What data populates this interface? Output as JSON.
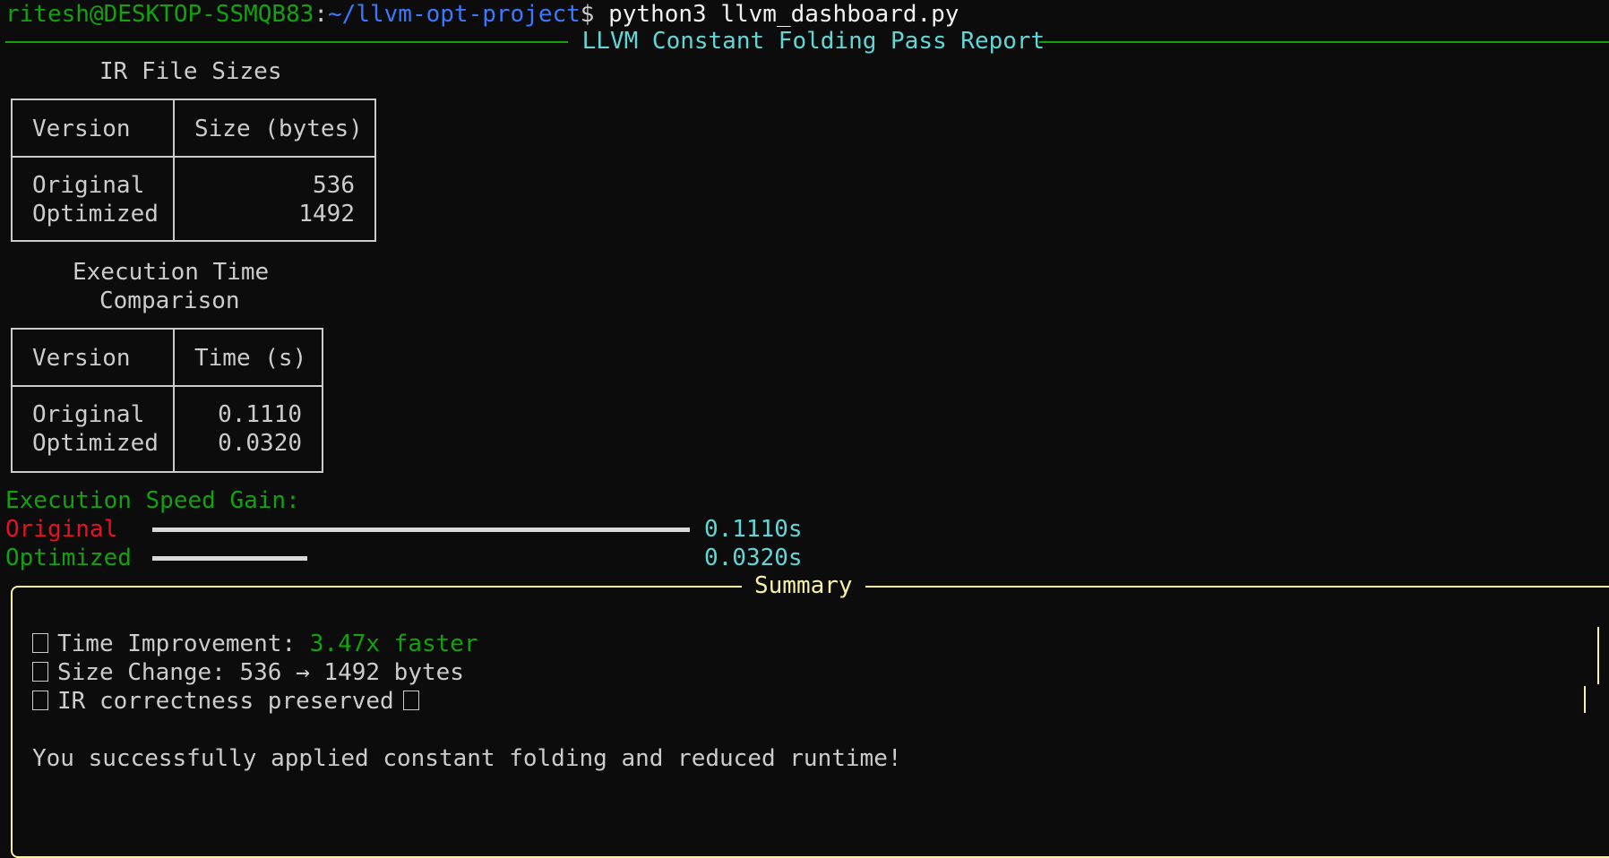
{
  "prompt": {
    "user_host": "ritesh@DESKTOP-SSMQB83",
    "separator": ":",
    "path": "~/llvm-opt-project",
    "dollar": "$",
    "command": " python3 llvm_dashboard.py"
  },
  "report_title": " LLVM Constant Folding Pass Report ",
  "ir_sizes": {
    "title": "IR File Sizes",
    "header": [
      "Version",
      "Size (bytes)"
    ],
    "rows": [
      {
        "version": "Original",
        "value": "536"
      },
      {
        "version": "Optimized",
        "value": "1492"
      }
    ]
  },
  "exec_time": {
    "title_line1": "Execution Time",
    "title_line2": "Comparison",
    "header": [
      "Version",
      "Time (s)"
    ],
    "rows": [
      {
        "version": "Original",
        "value": "0.1110"
      },
      {
        "version": "Optimized",
        "value": "0.0320"
      }
    ]
  },
  "speed_gain": {
    "title": "Execution Speed Gain:",
    "bars": [
      {
        "label": "Original",
        "value_text": "0.1110s",
        "fraction": 1.0
      },
      {
        "label": "Optimized",
        "value_text": "0.0320s",
        "fraction": 0.288
      }
    ]
  },
  "summary": {
    "title": "Summary",
    "time_label": "Time Improvement: ",
    "time_value": "3.47x faster",
    "size_line": "Size Change: 536 → 1492 bytes",
    "correct_line": "IR correctness preserved",
    "message": "You successfully applied constant folding and reduced runtime!"
  },
  "colors": {
    "background": "#0c0c0c",
    "green": "#13a10e",
    "blue": "#3b78ff",
    "cyan": "#61d6d6",
    "red": "#e81123",
    "yellow": "#f9f1a5"
  }
}
